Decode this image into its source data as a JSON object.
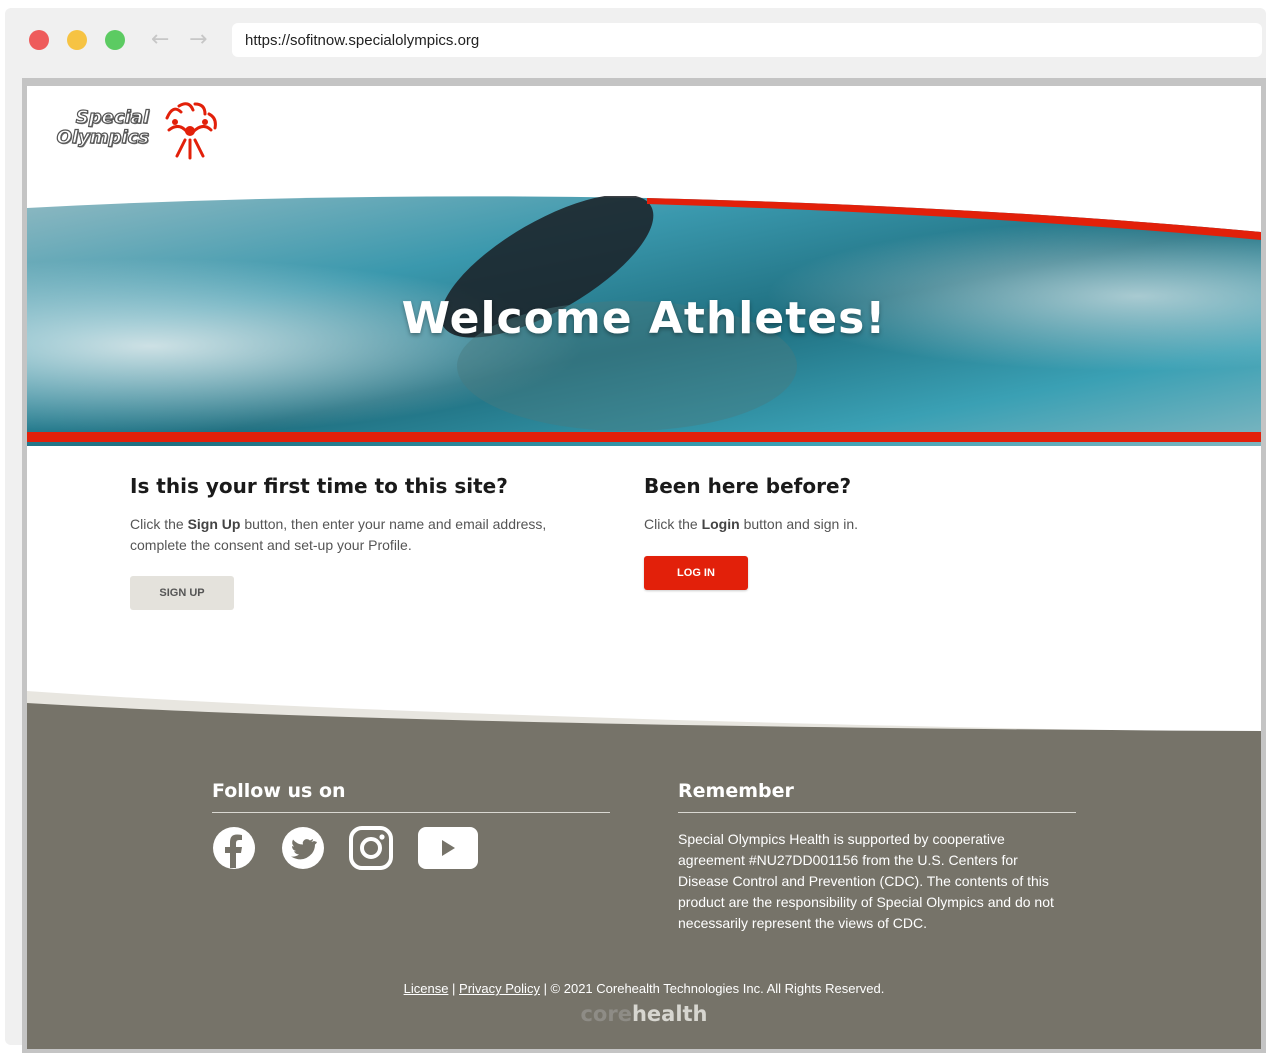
{
  "browser": {
    "url": "https://sofitnow.specialolympics.org"
  },
  "header": {
    "logo_line1": "Special",
    "logo_line2": "Olympics"
  },
  "hero": {
    "title": "Welcome Athletes!"
  },
  "signup": {
    "heading": "Is this your first time to this site?",
    "text_pre": "Click the ",
    "text_bold": "Sign Up",
    "text_post": " button,  then enter your name and email address, complete the consent and set-up your Profile.",
    "button_label": "SIGN UP"
  },
  "login": {
    "heading": "Been here before?",
    "text_pre": "Click the ",
    "text_bold": "Login",
    "text_post": " button and sign in.",
    "button_label": "LOG IN"
  },
  "footer": {
    "follow_title": "Follow us on",
    "social": [
      "facebook-icon",
      "twitter-icon",
      "instagram-icon",
      "youtube-icon"
    ],
    "remember_title": "Remember",
    "remember_text": "Special Olympics Health is supported by cooperative agreement #NU27DD001156 from the U.S. Centers for Disease Control and Prevention (CDC). The contents of this product are the responsibility of Special Olympics and do not necessarily represent the views of CDC.",
    "license_link": "License",
    "separator": " | ",
    "privacy_link": "Privacy Policy",
    "copyright": " | © 2021 Corehealth Technologies Inc. All Rights Reserved.",
    "brand_core": "core",
    "brand_health": "health"
  },
  "colors": {
    "accent_red": "#e2200a",
    "footer_gray": "#767369",
    "hero_water": "#2e8fa3"
  }
}
